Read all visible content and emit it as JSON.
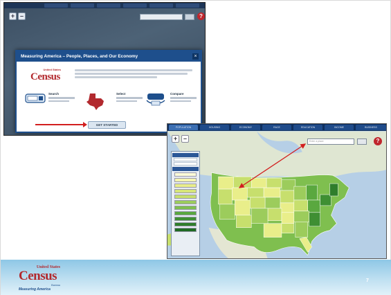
{
  "modal": {
    "title": "Measuring America – People, Places, and Our Economy",
    "close_glyph": "×",
    "start_button": "GET STARTED",
    "options": [
      {
        "label": "Search"
      },
      {
        "label": "Select"
      },
      {
        "label": "Compare"
      }
    ]
  },
  "logo": {
    "united_states": "United States",
    "wordmark": "Census",
    "bureau": "Bureau",
    "tagline": "Measuring America"
  },
  "map_app": {
    "tabs": [
      "POPULATION",
      "HOUSING",
      "ECONOMY",
      "RACE",
      "EDUCATION",
      "INCOME",
      "BUSINESS"
    ],
    "zoom_in": "+",
    "zoom_out": "–",
    "help_glyph": "?",
    "search_placeholder": "Enter a place"
  },
  "colors": {
    "census_red": "#b2292e",
    "census_blue": "#1e4f8c",
    "arrow_red": "#d21f1f"
  },
  "slide": {
    "page_number": "7"
  }
}
